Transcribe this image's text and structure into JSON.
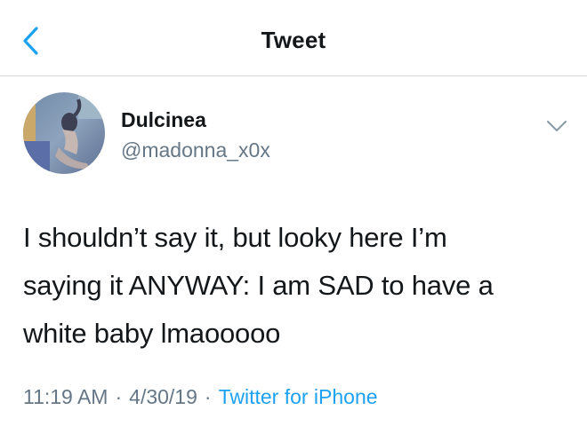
{
  "header": {
    "title": "Tweet",
    "back_icon": "chevron-left-icon",
    "accent_color": "#1da1f2"
  },
  "author": {
    "display_name": "Dulcinea",
    "handle": "@madonna_x0x",
    "menu_icon": "chevron-down-icon"
  },
  "tweet": {
    "lines": [
      "I shouldn’t say it, but looky here I’m",
      "saying it ANYWAY: I am SAD to have a",
      "white baby lmaooooo"
    ]
  },
  "meta": {
    "time": "11:19 AM",
    "date": "4/30/19",
    "separator": "·",
    "source": "Twitter for iPhone"
  },
  "colors": {
    "text": "#14171a",
    "secondary": "#657786",
    "link": "#1da1f2",
    "divider": "#d6d9dc"
  }
}
